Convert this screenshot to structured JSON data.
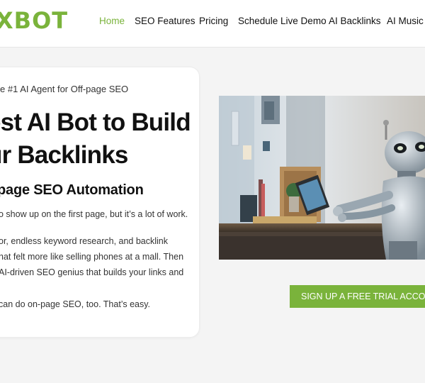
{
  "brand": {
    "logo_text": "XBOT",
    "accent_color": "#7ab33b"
  },
  "nav": {
    "items": [
      {
        "label": "Home",
        "active": true
      },
      {
        "label": "SEO Features"
      },
      {
        "label": "Pricing"
      },
      {
        "label": "Schedule Live Demo"
      },
      {
        "label": "AI Backlinks"
      },
      {
        "label": "AI Music V"
      }
    ]
  },
  "hero": {
    "eyebrow": "e #1 AI Agent for Off-page SEO",
    "title_line1": "est AI Bot to Build",
    "title_line2": "ur Backlinks",
    "subhead": "page SEO Automation",
    "p1": "o show up on the first page, but it’s a lot of work.",
    "p2_line1": "or, endless keyword research, and backlink",
    "p2_line2": "hat felt more like selling phones at a mall. Then",
    "p2_line3": "AI-driven SEO genius that builds your links and",
    "p3": "can do on-page SEO, too. That’s easy.",
    "cta_label": "SIGN UP A FREE TRIAL ACCOUNT"
  }
}
